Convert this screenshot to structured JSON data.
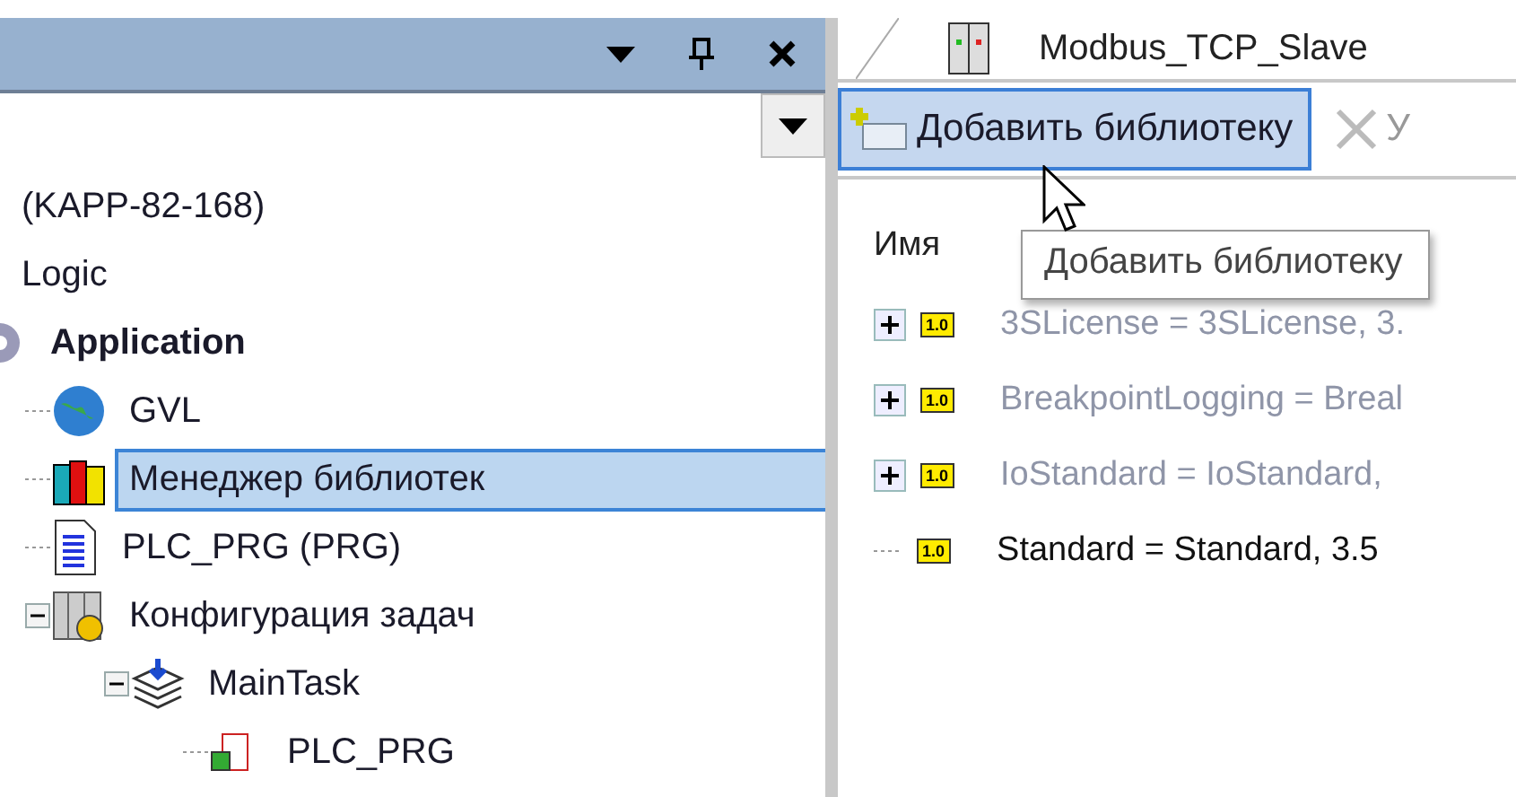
{
  "left_panel": {
    "tree": [
      {
        "label": "(KAPP-82-168)",
        "selected": false,
        "children": [
          {
            "label": "Logic",
            "selected": false,
            "children": [
              {
                "label": "Application",
                "kind": "application",
                "bold": true,
                "selected": false,
                "children": [
                  {
                    "label": "GVL",
                    "kind": "globals",
                    "selected": false
                  },
                  {
                    "label": "Менеджер библиотек",
                    "kind": "libraries",
                    "selected": true
                  },
                  {
                    "label": "PLC_PRG (PRG)",
                    "kind": "pou",
                    "selected": false
                  },
                  {
                    "label": "Конфигурация задач",
                    "kind": "taskconfig",
                    "selected": false,
                    "expanded": true,
                    "children": [
                      {
                        "label": "MainTask",
                        "kind": "task",
                        "selected": false,
                        "expanded": true,
                        "children": [
                          {
                            "label": "PLC_PRG",
                            "kind": "call",
                            "selected": false
                          }
                        ]
                      }
                    ]
                  }
                ]
              }
            ]
          }
        ]
      }
    ]
  },
  "editor": {
    "tab": {
      "title": "Modbus_TCP_Slave"
    },
    "toolbar": [
      {
        "kind": "add",
        "label": "Добавить библиотеку",
        "hovered": true
      },
      {
        "kind": "delete",
        "label": "У",
        "hovered": false
      }
    ],
    "tooltip": "Добавить библиотеку",
    "column_header": "Имя",
    "libraries": [
      {
        "label": "3SLicense = 3SLicense, 3.",
        "badge": "1.0",
        "dimmed": true,
        "expandable": true
      },
      {
        "label": "BreakpointLogging = Breal",
        "badge": "1.0",
        "dimmed": true,
        "expandable": true
      },
      {
        "label": "IoStandard = IoStandard,",
        "badge": "1.0",
        "dimmed": true,
        "expandable": true
      },
      {
        "label": "Standard = Standard, 3.5",
        "badge": "1.0",
        "dimmed": false,
        "expandable": false
      }
    ]
  }
}
